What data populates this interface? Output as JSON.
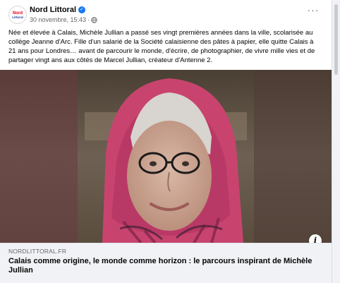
{
  "post": {
    "author": "Nord Littoral",
    "date": "30 novembre, 15:43",
    "separator": "·",
    "avatar_text_top": "Nord",
    "avatar_text_bottom": "Littoral",
    "body": "Née et élevée à Calais, Michèle Jullian a passé ses vingt premières années dans la ville, scolarisée au collège Jeanne d'Arc. Fille d'un salarié de la Société calaisienne des pâtes à papier, elle quitte Calais à 21 ans pour Londres… avant de parcourir le monde, d'écrire, de photographier, de vivre mille vies et de partager vingt ans aux côtés de Marcel Jullian, créateur d'Antenne 2.",
    "more_label": "···"
  },
  "link": {
    "domain": "NORDLITTORAL.FR",
    "title": "Calais comme origine, le monde comme horizon : le parcours inspirant de Michèle Jullian",
    "info_label": "i"
  },
  "colors": {
    "brand_blue": "#1877f2",
    "brand_red": "#e2001a",
    "secondary_text": "#65676b",
    "link_bg": "#f0f2f5"
  },
  "icons": {
    "verified": "verified-badge-icon",
    "privacy": "globe-icon",
    "more": "more-options-icon",
    "info": "info-icon"
  }
}
